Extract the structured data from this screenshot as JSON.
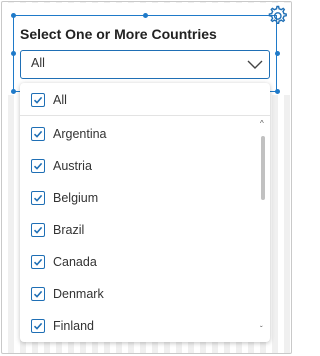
{
  "title": "Select One or More Countries",
  "select": {
    "value": "All"
  },
  "dropdown": {
    "all_label": "All",
    "items": [
      {
        "label": "Argentina",
        "checked": true
      },
      {
        "label": "Austria",
        "checked": true
      },
      {
        "label": "Belgium",
        "checked": true
      },
      {
        "label": "Brazil",
        "checked": true
      },
      {
        "label": "Canada",
        "checked": true
      },
      {
        "label": "Denmark",
        "checked": true
      },
      {
        "label": "Finland",
        "checked": true
      }
    ]
  },
  "colors": {
    "accent": "#1f6fb5",
    "selection_border": "#1f7ac9"
  },
  "icons": {
    "settings": "gear-icon",
    "dropdown": "chevron-down-icon",
    "checkbox": "check-icon"
  }
}
